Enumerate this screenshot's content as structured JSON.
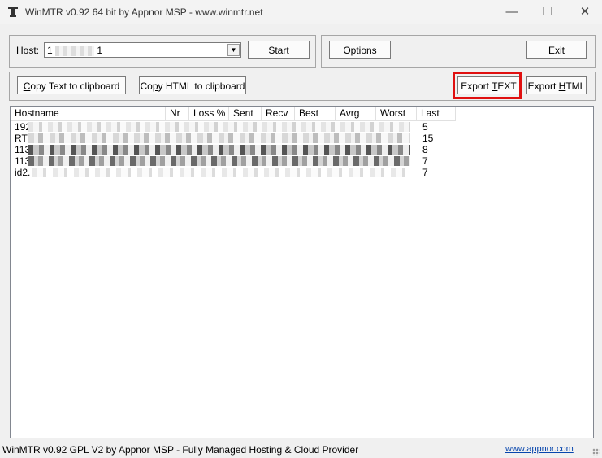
{
  "window": {
    "title": "WinMTR v0.92 64 bit by Appnor MSP - www.winmtr.net",
    "min_glyph": "—",
    "max_glyph": "☐",
    "close_glyph": "✕"
  },
  "host": {
    "label": "Host:",
    "value_start": "1",
    "value_end": "1"
  },
  "buttons": {
    "start": "Start",
    "options_accel": "O",
    "options_rest": "ptions",
    "exit_pre": "E",
    "exit_accel": "x",
    "exit_rest": "it",
    "copy_text_accel": "C",
    "copy_text_rest": "opy Text to clipboard",
    "copy_html_pre": "Co",
    "copy_html_accel": "p",
    "copy_html_rest": "y HTML to clipboard",
    "export_text_pre": "Export ",
    "export_text_accel": "T",
    "export_text_rest": "EXT",
    "export_html_pre": "Export ",
    "export_html_accel": "H",
    "export_html_rest": "TML"
  },
  "table": {
    "columns": [
      "Hostname",
      "Nr",
      "Loss %",
      "Sent",
      "Recv",
      "Best",
      "Avrg",
      "Worst",
      "Last"
    ],
    "rows": [
      {
        "hostname": "192",
        "last": "5"
      },
      {
        "hostname": "RTI",
        "last": "15"
      },
      {
        "hostname": "113",
        "last": "8"
      },
      {
        "hostname": "113",
        "last": "7"
      },
      {
        "hostname": "id2.",
        "last": "7"
      }
    ]
  },
  "status": {
    "text": "WinMTR v0.92 GPL V2 by Appnor MSP - Fully Managed Hosting & Cloud Provider",
    "link": "www.appnor.com"
  }
}
